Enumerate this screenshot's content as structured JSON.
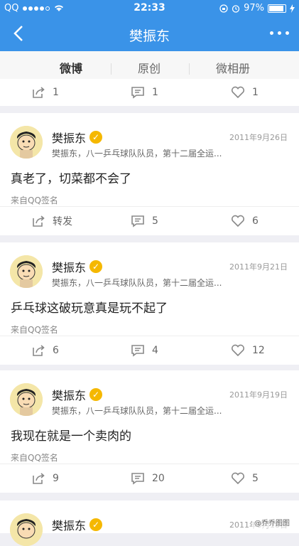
{
  "status_bar": {
    "carrier": "QQ",
    "time": "22:33",
    "battery": "97%"
  },
  "nav": {
    "title": "樊振东"
  },
  "tabs": [
    {
      "label": "微博",
      "active": true
    },
    {
      "label": "原创",
      "active": false
    },
    {
      "label": "微相册",
      "active": false
    }
  ],
  "top_actions": {
    "repost": "1",
    "comment": "1",
    "like": "1"
  },
  "posts": [
    {
      "name": "樊振东",
      "date": "2011年9月26日",
      "desc": "樊振东，八一乒乓球队队员，第十二届全运...",
      "text": "真老了，切菜都不会了",
      "source": "来自QQ签名",
      "repost": "转发",
      "comment": "5",
      "like": "6"
    },
    {
      "name": "樊振东",
      "date": "2011年9月21日",
      "desc": "樊振东，八一乒乓球队队员，第十二届全运...",
      "text": "乒乓球这破玩意真是玩不起了",
      "source": "来自QQ签名",
      "repost": "6",
      "comment": "4",
      "like": "12"
    },
    {
      "name": "樊振东",
      "date": "2011年9月19日",
      "desc": "樊振东，八一乒乓球队队员，第十二届全运...",
      "text": "我现在就是一个卖肉的",
      "source": "来自QQ签名",
      "repost": "9",
      "comment": "20",
      "like": "5"
    },
    {
      "name": "樊振东",
      "date": "2011年9月18日"
    }
  ],
  "watermark": "@乔乔图图",
  "colors": {
    "accent": "#3a93e8",
    "badge": "#f5b800"
  }
}
